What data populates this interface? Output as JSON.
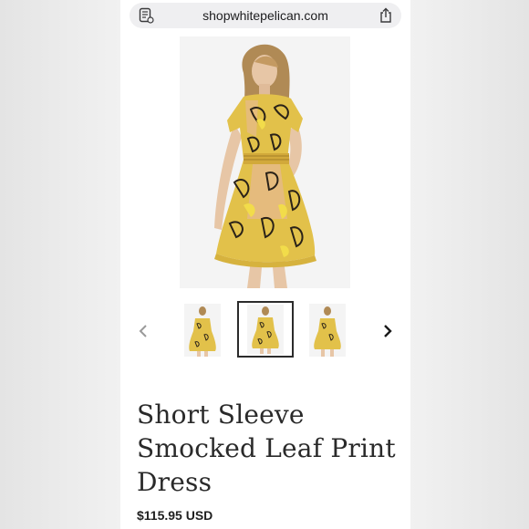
{
  "browser": {
    "url": "shopwhitepelican.com",
    "reader_icon": "reader-mode-icon",
    "share_icon": "share-icon"
  },
  "gallery": {
    "main_image": "dress-model-image",
    "thumbnails": [
      "thumbnail-1",
      "thumbnail-2",
      "thumbnail-3"
    ],
    "selected_index": 1,
    "prev_icon": "chevron-left-icon",
    "next_icon": "chevron-right-icon"
  },
  "product": {
    "title": "Short Sleeve Smocked Leaf Print Dress",
    "price": "$115.95 USD"
  },
  "colors": {
    "dress_yellow": "#e2c14a",
    "dress_pink": "#e8b7a8",
    "leaf_dark": "#2a2218",
    "hair": "#b08a55",
    "skin": "#e7c6a6",
    "page_bg": "#ffffff",
    "urlbar_bg": "#efeff1"
  }
}
